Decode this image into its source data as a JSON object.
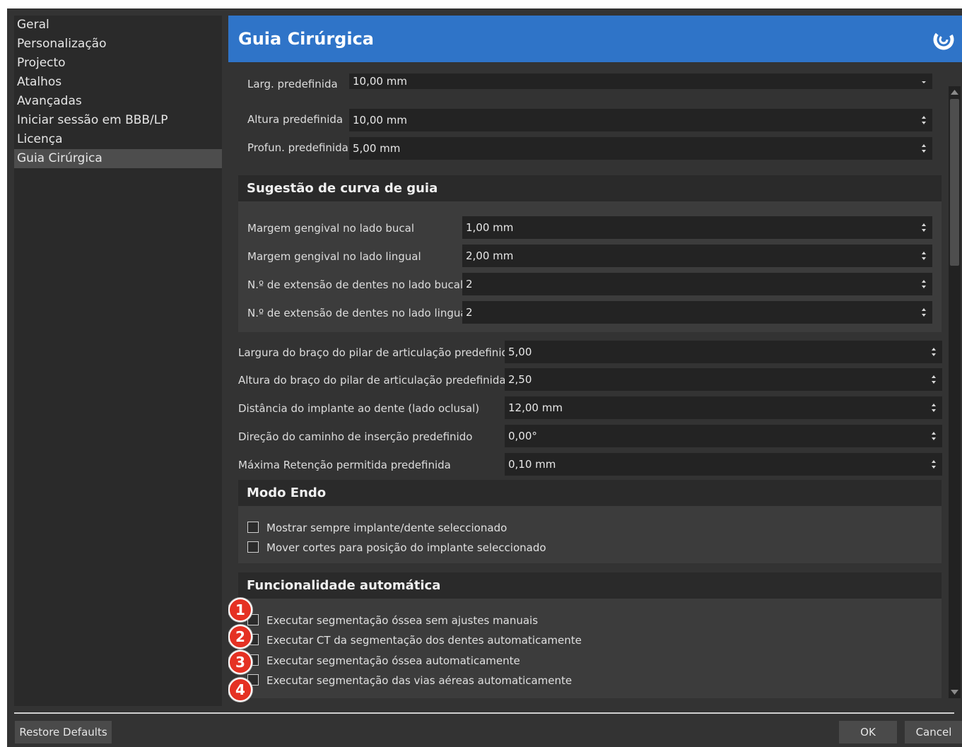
{
  "sidebar": {
    "items": [
      {
        "label": "Geral"
      },
      {
        "label": "Personalização"
      },
      {
        "label": "Projecto"
      },
      {
        "label": "Atalhos"
      },
      {
        "label": "Avançadas"
      },
      {
        "label": "Iniciar sessão em BBB/LP"
      },
      {
        "label": "Licença"
      },
      {
        "label": "Guia Cirúrgica",
        "active": true
      }
    ]
  },
  "header": {
    "title": "Guia Cirúrgica",
    "logo_icon": "swirl-logo-icon"
  },
  "top_fields": [
    {
      "label": "Larg. predefinida",
      "value": "10,00 mm"
    },
    {
      "label": "Altura predefinida",
      "value": "10,00 mm"
    },
    {
      "label": "Profun. predefinida",
      "value": "5,00 mm"
    }
  ],
  "curve_group": {
    "title": "Sugestão de curva de guia",
    "fields": [
      {
        "label": "Margem gengival no lado bucal",
        "value": "1,00 mm"
      },
      {
        "label": "Margem gengival no lado lingual",
        "value": "2,00 mm"
      },
      {
        "label": "N.º de extensão de dentes no lado bucal",
        "value": "2"
      },
      {
        "label": "N.º de extensão de dentes no lado lingual",
        "value": "2"
      }
    ]
  },
  "main_fields": [
    {
      "label": "Largura do braço do pilar de articulação predefinida",
      "value": "5,00"
    },
    {
      "label": "Altura do braço do pilar de articulação predefinida",
      "value": "2,50"
    },
    {
      "label": "Distância do implante ao dente (lado oclusal)",
      "value": "12,00 mm"
    },
    {
      "label": "Direção do caminho de inserção predefinido",
      "value": "0,00°"
    },
    {
      "label": "Máxima Retenção permitida predefinida",
      "value": "0,10 mm"
    }
  ],
  "endo_group": {
    "title": "Modo Endo",
    "options": [
      {
        "label": "Mostrar sempre implante/dente seleccionado",
        "checked": false
      },
      {
        "label": "Mover cortes para posição do implante seleccionado",
        "checked": false
      }
    ]
  },
  "auto_group": {
    "title": "Funcionalidade automática",
    "options": [
      {
        "label": "Executar segmentação óssea sem ajustes manuais",
        "checked": false
      },
      {
        "label": "Executar CT da segmentação dos dentes automaticamente",
        "checked": false
      },
      {
        "label": "Executar segmentação óssea automaticamente",
        "checked": false
      },
      {
        "label": "Executar segmentação das vias aéreas automaticamente",
        "checked": false
      }
    ]
  },
  "badges": [
    "1",
    "2",
    "3",
    "4"
  ],
  "footer": {
    "restore": "Restore Defaults",
    "ok": "OK",
    "cancel": "Cancel"
  },
  "colors": {
    "header": "#2f74c8",
    "badge": "#e53123",
    "background": "#333333"
  }
}
